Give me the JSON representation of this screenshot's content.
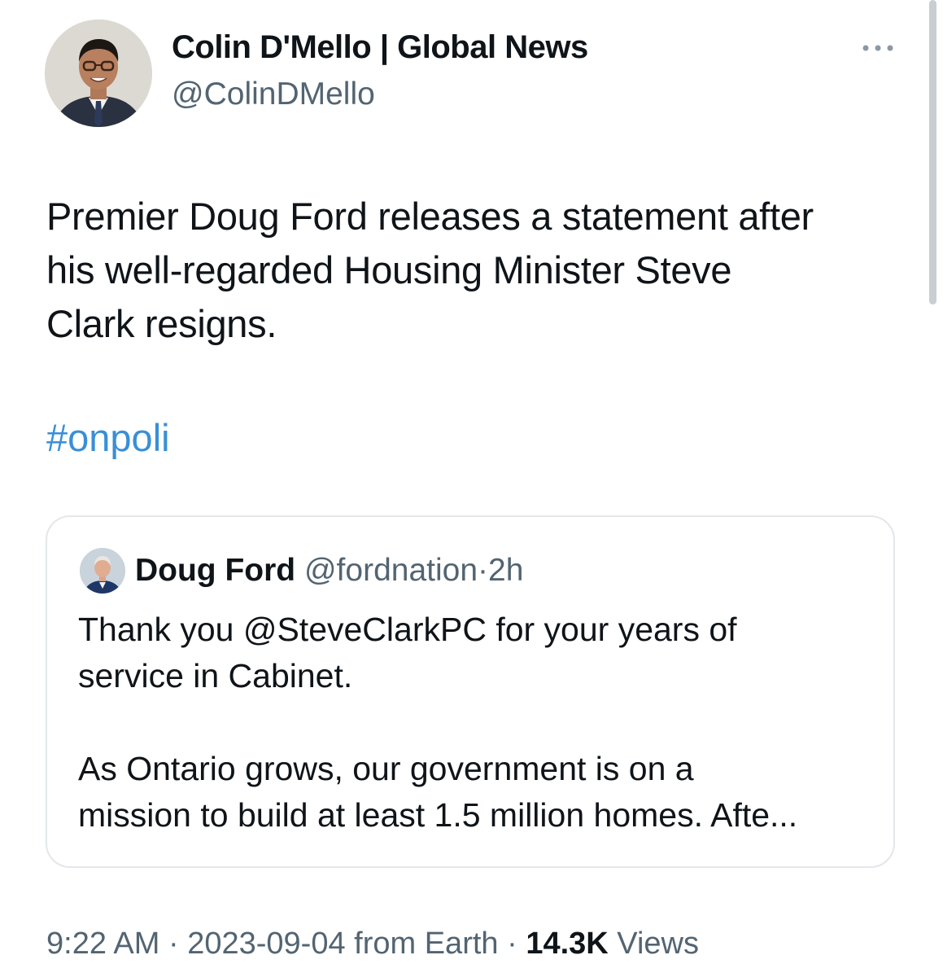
{
  "author": {
    "display_name": "Colin D'Mello | Global News",
    "handle": "@ColinDMello",
    "avatar_icon": "profile-photo"
  },
  "more_icon": "more-horizontal-icon",
  "tweet": {
    "text_lines": [
      "Premier Doug Ford releases a statement after",
      "his well-regarded Housing Minister Steve",
      "Clark resigns."
    ],
    "hashtag": "#onpoli"
  },
  "quote": {
    "display_name": "Doug Ford",
    "handle": "@fordnation",
    "separator": "·",
    "time": "2h",
    "avatar_icon": "profile-photo",
    "text_lines": [
      "Thank you @SteveClarkPC for your years of",
      "service in Cabinet.",
      "",
      "As Ontario grows, our government is on a",
      "mission to build at least 1.5 million homes. Afte..."
    ]
  },
  "meta": {
    "time": "9:22 AM",
    "sep1": "·",
    "date": "2023-09-04",
    "source": "from Earth",
    "sep2": "·",
    "views_count": "14.3K",
    "views_label": "Views"
  },
  "colors": {
    "link": "#3a8fd6",
    "secondary_text": "#536471",
    "primary_text": "#0f1419",
    "border": "#e3e7ea"
  }
}
